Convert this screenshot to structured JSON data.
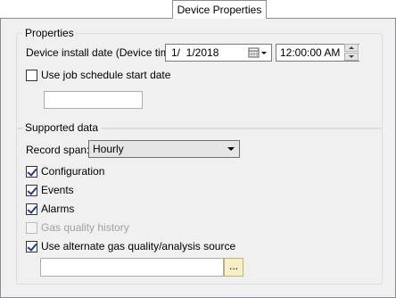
{
  "tab": {
    "label": "Device Properties"
  },
  "properties": {
    "legend": "Properties",
    "install_date_label": "Device install date (Device time):",
    "date_value": "1/  1/2018",
    "time_value": "12:00:00 AM",
    "use_job_schedule_label": "Use job schedule start date",
    "use_job_schedule_checked": false,
    "job_schedule_value": ""
  },
  "supported": {
    "legend": "Supported data",
    "record_span_label": "Record span:",
    "record_span_value": "Hourly",
    "items": [
      {
        "label": "Configuration",
        "checked": true,
        "enabled": true
      },
      {
        "label": "Events",
        "checked": true,
        "enabled": true
      },
      {
        "label": "Alarms",
        "checked": true,
        "enabled": true
      },
      {
        "label": "Gas quality history",
        "checked": false,
        "enabled": false
      },
      {
        "label": "Use alternate gas quality/analysis source",
        "checked": true,
        "enabled": true
      }
    ],
    "source_value": "",
    "browse_label": "..."
  }
}
